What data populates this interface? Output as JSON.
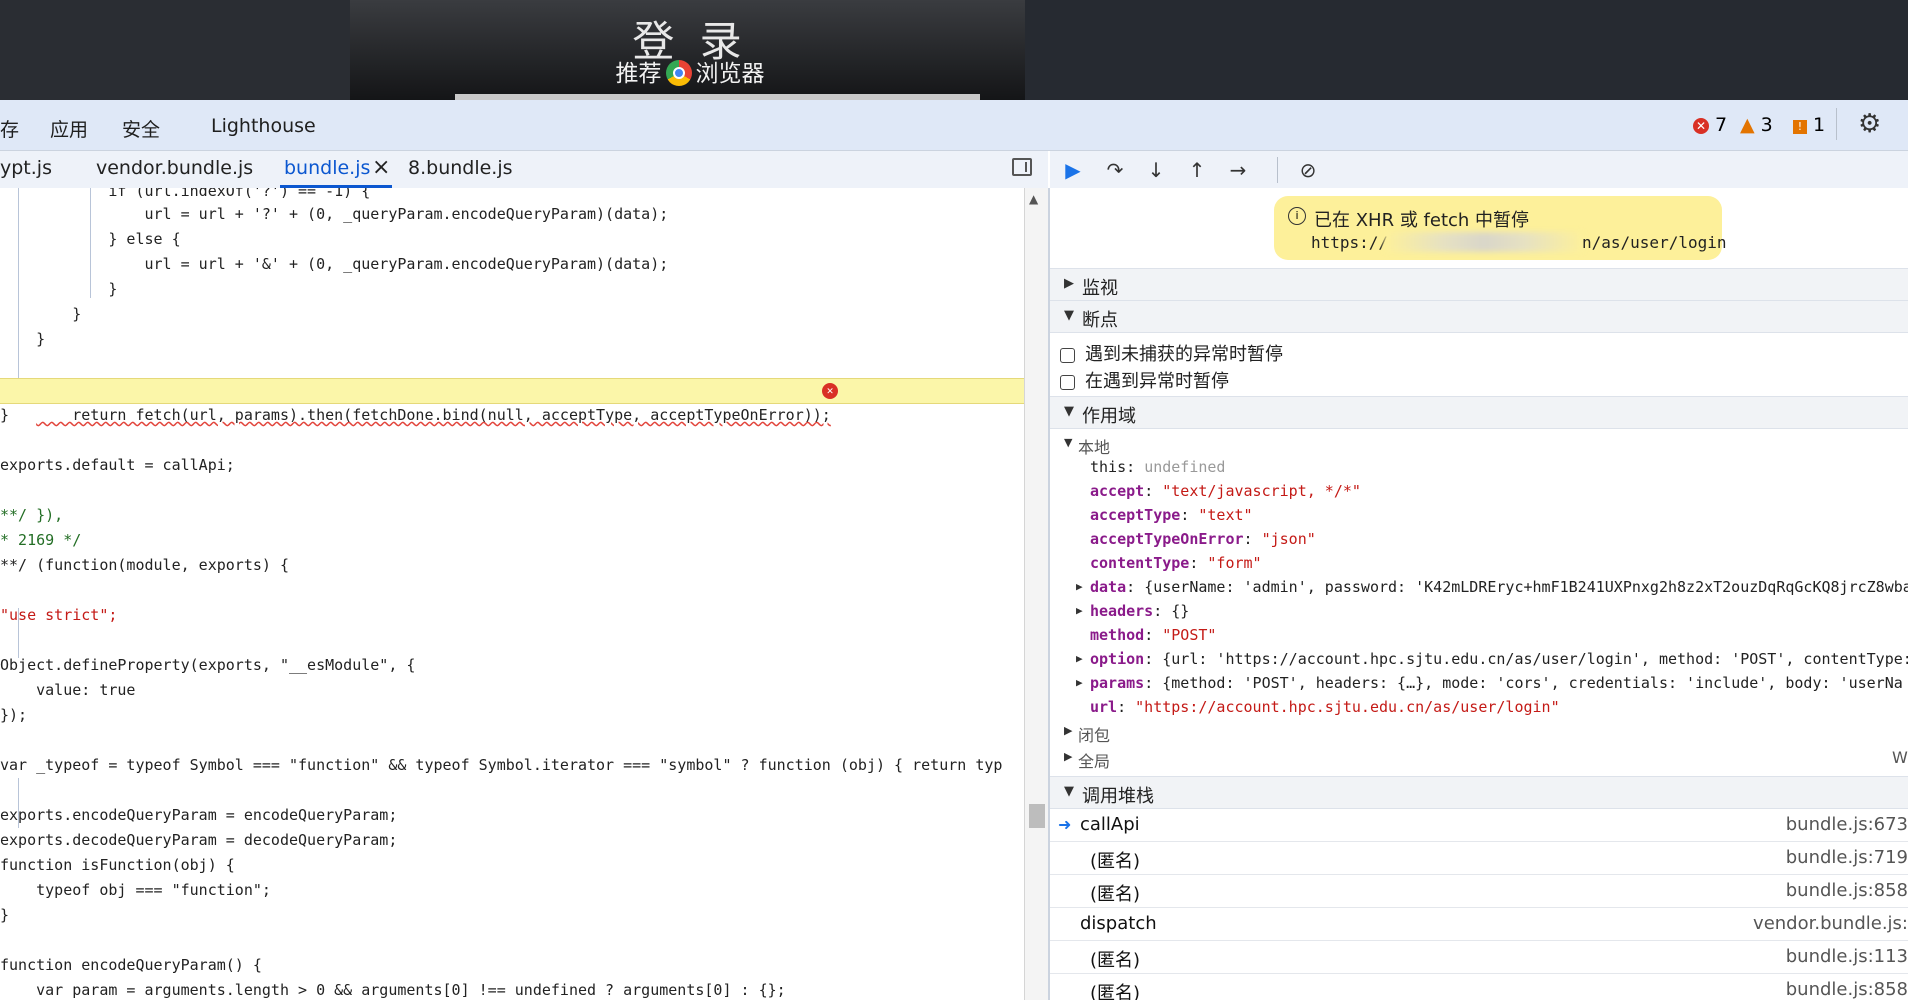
{
  "page": {
    "title": "登 录",
    "subtitle_left": "推荐",
    "subtitle_right": "浏览器"
  },
  "main_tabs": {
    "items": [
      "存",
      "应用",
      "安全",
      "Lighthouse"
    ],
    "errors": "7",
    "warnings": "3",
    "issues": "1"
  },
  "file_tabs": {
    "items": [
      "ypt.js",
      "vendor.bundle.js",
      "bundle.js",
      "8.bundle.js"
    ],
    "close": "×"
  },
  "code": {
    "lines": [
      "            if (url.indexOf('?') == -1) {",
      "                url = url + '?' + (0, _queryParam.encodeQueryParam)(data);",
      "            } else {",
      "                url = url + '&' + (0, _queryParam.encodeQueryParam)(data);",
      "            }",
      "        }",
      "    }",
      "",
      "    return fetch(url, params).then(fetchDone.bind(null, acceptType, acceptTypeOnError));",
      "}",
      "",
      "exports.default = callApi;",
      "",
      "**/ }),",
      "* 2169 */",
      "**/ (function(module, exports) {",
      "",
      "\"use strict\";",
      "",
      "Object.defineProperty(exports, \"__esModule\", {",
      "    value: true",
      "});",
      "",
      "var _typeof = typeof Symbol === \"function\" && typeof Symbol.iterator === \"symbol\" ? function (obj) { return typ",
      "",
      "exports.encodeQueryParam = encodeQueryParam;",
      "exports.decodeQueryParam = decodeQueryParam;",
      "function isFunction(obj) {",
      "    typeof obj === \"function\";",
      "}",
      "",
      "function encodeQueryParam() {",
      "    var param = arguments.length > 0 && arguments[0] !== undefined ? arguments[0] : {};"
    ]
  },
  "debugger": {
    "pause_title": "已在 XHR 或 fetch 中暂停",
    "pause_url_start": "https://",
    "pause_url_end": "n/as/user/login",
    "sections": {
      "watch": "监视",
      "breakpoints": "断点",
      "scope": "作用域",
      "call_stack": "调用堆栈"
    },
    "breakpoint_options": [
      "遇到未捕获的异常时暂停",
      "在遇到异常时暂停"
    ],
    "scope": {
      "local": "本地",
      "closure": "闭包",
      "global": "全局",
      "global_value": "Wi",
      "this_key": "this",
      "this_val": "undefined",
      "accept_key": "accept",
      "accept_val": "\"text/javascript, */*\"",
      "acceptType_key": "acceptType",
      "acceptType_val": "\"text\"",
      "acceptTypeOnError_key": "acceptTypeOnError",
      "acceptTypeOnError_val": "\"json\"",
      "contentType_key": "contentType",
      "contentType_val": "\"form\"",
      "data_key": "data",
      "data_val": "{userName: 'admin', password: 'K42mLDREryc+hmF1B241UXPnxg2h8z2xT2ouzDqRqGcKQ8jrcZ8wba",
      "headers_key": "headers",
      "headers_val": "{}",
      "method_key": "method",
      "method_val": "\"POST\"",
      "option_key": "option",
      "option_val": "{url: 'https://account.hpc.sjtu.edu.cn/as/user/login', method: 'POST', contentType:",
      "params_key": "params",
      "params_val": "{method: 'POST', headers: {…}, mode: 'cors', credentials: 'include', body: 'userNa",
      "url_key": "url",
      "url_val": "\"https://account.hpc.sjtu.edu.cn/as/user/login\""
    },
    "call_stack": [
      {
        "name": "callApi",
        "loc": "bundle.js:673"
      },
      {
        "name": "(匿名)",
        "loc": "bundle.js:719"
      },
      {
        "name": "(匿名)",
        "loc": "bundle.js:858"
      },
      {
        "name": "dispatch",
        "loc": "vendor.bundle.js:"
      },
      {
        "name": "(匿名)",
        "loc": "bundle.js:113"
      },
      {
        "name": "(匿名)",
        "loc": "bundle.js:858"
      }
    ]
  }
}
